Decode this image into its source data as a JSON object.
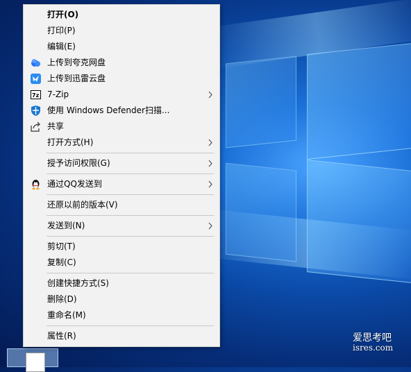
{
  "context_menu": {
    "items": [
      {
        "label": "打开(O)",
        "bold": true,
        "icon": "",
        "submenu": false
      },
      {
        "label": "打印(P)",
        "bold": false,
        "icon": "",
        "submenu": false
      },
      {
        "label": "编辑(E)",
        "bold": false,
        "icon": "",
        "submenu": false
      },
      {
        "label": "上传到夸克网盘",
        "bold": false,
        "icon": "quark-cloud-icon",
        "submenu": false
      },
      {
        "label": "上传到迅雷云盘",
        "bold": false,
        "icon": "xunlei-cloud-icon",
        "submenu": false
      },
      {
        "label": "7-Zip",
        "bold": false,
        "icon": "7zip-icon",
        "submenu": true
      },
      {
        "label": "使用 Windows Defender扫描...",
        "bold": false,
        "icon": "windows-defender-icon",
        "submenu": false
      },
      {
        "label": "共享",
        "bold": false,
        "icon": "share-icon",
        "submenu": false
      },
      {
        "label": "打开方式(H)",
        "bold": false,
        "icon": "",
        "submenu": true
      },
      {
        "label": "授予访问权限(G)",
        "bold": false,
        "icon": "",
        "submenu": true
      },
      {
        "label": "通过QQ发送到",
        "bold": false,
        "icon": "qq-icon",
        "submenu": true
      },
      {
        "label": "还原以前的版本(V)",
        "bold": false,
        "icon": "",
        "submenu": false
      },
      {
        "label": "发送到(N)",
        "bold": false,
        "icon": "",
        "submenu": true
      },
      {
        "label": "剪切(T)",
        "bold": false,
        "icon": "",
        "submenu": false
      },
      {
        "label": "复制(C)",
        "bold": false,
        "icon": "",
        "submenu": false
      },
      {
        "label": "创建快捷方式(S)",
        "bold": false,
        "icon": "",
        "submenu": false
      },
      {
        "label": "删除(D)",
        "bold": false,
        "icon": "",
        "submenu": false
      },
      {
        "label": "重命名(M)",
        "bold": false,
        "icon": "",
        "submenu": false
      },
      {
        "label": "属性(R)",
        "bold": false,
        "icon": "",
        "submenu": false
      }
    ]
  },
  "watermark": {
    "line1": "爱思考吧",
    "line2": "isres.com"
  },
  "colors": {
    "menu_bg": "#f2f2f2",
    "separator": "#c8c8c8",
    "desktop_blue": "#0b4aa8"
  }
}
